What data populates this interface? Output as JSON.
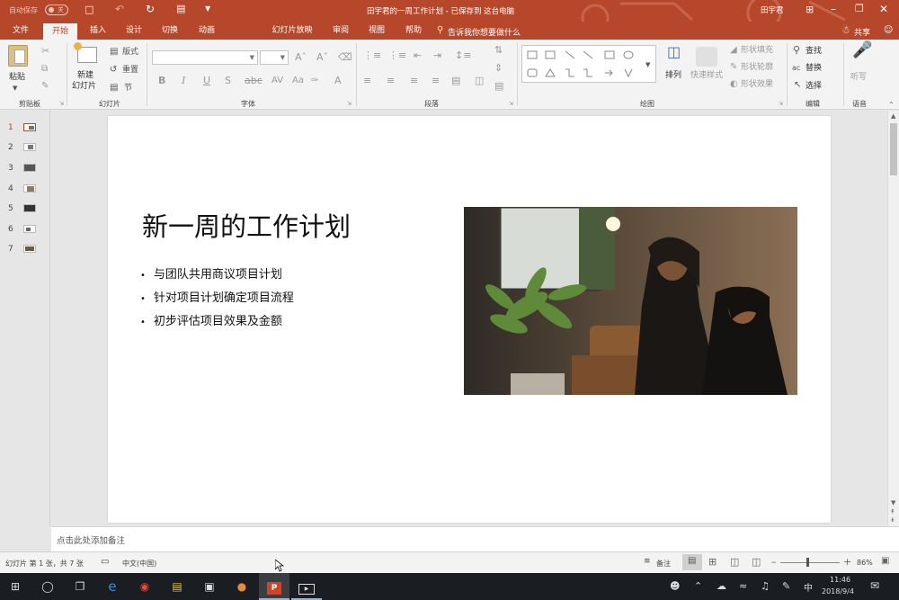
{
  "titlebar": {
    "autosave_label": "自动保存",
    "autosave_state": "关",
    "doc_title": "田宇君的一周工作计划 - 已保存到 这台电脑",
    "user_name": "田宇君",
    "save_icon": "save-icon",
    "undo_icon": "undo-icon",
    "redo_icon": "redo-icon",
    "present_icon": "present-icon",
    "accent_color": "#b7472a"
  },
  "tabs": [
    {
      "label": "文件"
    },
    {
      "label": "开始"
    },
    {
      "label": "插入"
    },
    {
      "label": "设计"
    },
    {
      "label": "切换"
    },
    {
      "label": "动画"
    },
    {
      "label": "幻灯片放映"
    },
    {
      "label": "审阅"
    },
    {
      "label": "视图"
    },
    {
      "label": "帮助"
    }
  ],
  "tell_me": "告诉我你想要做什么",
  "share_label": "共享",
  "ribbon": {
    "clipboard": {
      "paste": "粘贴",
      "group": "剪贴板"
    },
    "slides": {
      "new_slide": "新建",
      "new_slide2": "幻灯片",
      "layout": "版式",
      "reset": "重置",
      "section": "节",
      "group": "幻灯片"
    },
    "font": {
      "group": "字体"
    },
    "paragraph": {
      "group": "段落"
    },
    "drawing": {
      "arrange": "排列",
      "quick_styles": "快速样式",
      "shape_fill": "形状填充",
      "shape_outline": "形状轮廓",
      "shape_effects": "形状效果",
      "group": "绘图"
    },
    "editing": {
      "find": "查找",
      "replace": "替换",
      "select": "选择",
      "group": "编辑"
    },
    "voice": {
      "dictate": "听写",
      "group": "语音"
    }
  },
  "thumbnails": [
    "1",
    "2",
    "3",
    "4",
    "5",
    "6",
    "7"
  ],
  "slide": {
    "title": "新一周的工作计划",
    "bullets": [
      "与团队共用商议项目计划",
      "针对项目计划确定项目流程",
      "初步评估项目效果及金额"
    ]
  },
  "notes_placeholder": "点击此处添加备注",
  "status": {
    "slide_info": "幻灯片 第 1 张，共 7 张",
    "language": "中文(中国)",
    "notes_btn": "备注",
    "zoom": "86%"
  },
  "taskbar": {
    "time": "11:46",
    "date": "2018/9/4",
    "ime": "中"
  }
}
